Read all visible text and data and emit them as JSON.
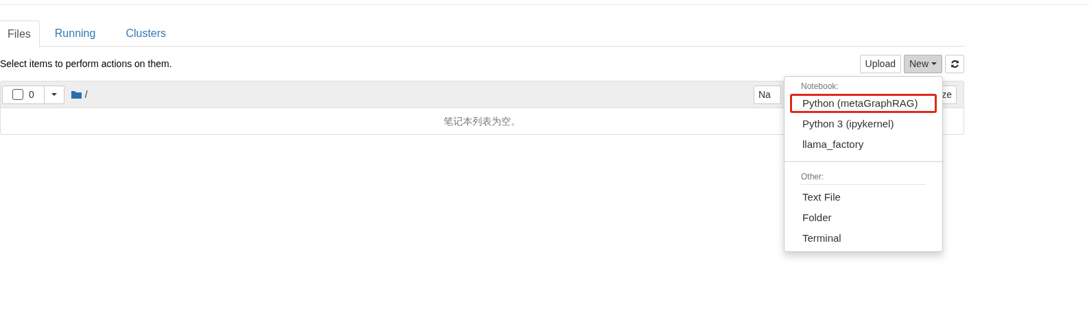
{
  "tabs": [
    {
      "label": "Files",
      "selected": true
    },
    {
      "label": "Running",
      "selected": false
    },
    {
      "label": "Clusters",
      "selected": false
    }
  ],
  "instructions": "Select items to perform actions on them.",
  "toolbar": {
    "upload": "Upload",
    "new": "New"
  },
  "list_header": {
    "select_all_checked": false,
    "selected_count": "0",
    "path": "/",
    "sort_name": "Na",
    "sort_size": "ze"
  },
  "empty_message": "笔记本列表为空。",
  "new_menu": {
    "sections": [
      {
        "header": "Notebook:",
        "items": [
          {
            "label": "Python (metaGraphRAG)",
            "highlighted": true
          },
          {
            "label": "Python 3 (ipykernel)",
            "highlighted": false
          },
          {
            "label": "llama_factory",
            "highlighted": false
          }
        ]
      },
      {
        "header": "Other:",
        "items": [
          {
            "label": "Text File",
            "highlighted": false
          },
          {
            "label": "Folder",
            "highlighted": false
          },
          {
            "label": "Terminal",
            "highlighted": false
          }
        ]
      }
    ]
  }
}
